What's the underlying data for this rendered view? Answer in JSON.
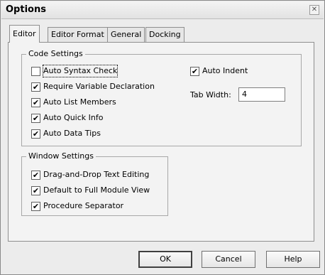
{
  "window": {
    "title": "Options",
    "close_glyph": "✕"
  },
  "tabs": [
    {
      "label": "Editor",
      "active": true
    },
    {
      "label": "Editor Format",
      "active": false
    },
    {
      "label": "General",
      "active": false
    },
    {
      "label": "Docking",
      "active": false
    }
  ],
  "code_settings": {
    "title": "Code Settings",
    "options": [
      {
        "label": "Auto Syntax Check",
        "checked": false
      },
      {
        "label": "Require Variable Declaration",
        "checked": true
      },
      {
        "label": "Auto List Members",
        "checked": true
      },
      {
        "label": "Auto Quick Info",
        "checked": true
      },
      {
        "label": "Auto Data Tips",
        "checked": true
      }
    ],
    "auto_indent": {
      "label": "Auto Indent",
      "checked": true
    },
    "tab_width": {
      "label": "Tab Width:",
      "value": "4"
    }
  },
  "window_settings": {
    "title": "Window Settings",
    "options": [
      {
        "label": "Drag-and-Drop Text Editing",
        "checked": true
      },
      {
        "label": "Default to Full Module View",
        "checked": true
      },
      {
        "label": "Procedure Separator",
        "checked": true
      }
    ]
  },
  "buttons": {
    "ok": "OK",
    "cancel": "Cancel",
    "help": "Help"
  },
  "check_glyph": "✔"
}
